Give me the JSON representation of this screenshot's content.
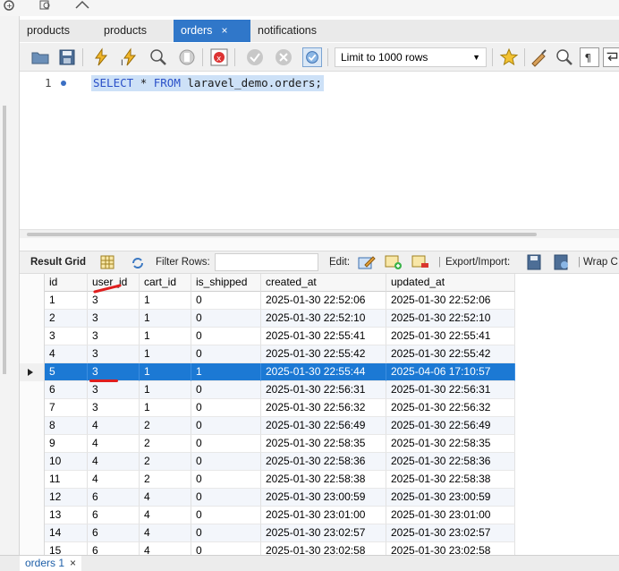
{
  "tabs": [
    {
      "label": "products",
      "active": false
    },
    {
      "label": "products",
      "active": false
    },
    {
      "label": "orders",
      "active": true,
      "close": "×"
    },
    {
      "label": "notifications",
      "active": false
    }
  ],
  "toolbar": {
    "limit_label": "Limit to 1000 rows",
    "icons": [
      "open-folder-icon",
      "save-icon",
      "execute-icon",
      "execute-current-icon",
      "explain-icon",
      "stop-icon",
      "toggle-error-icon",
      "commit-icon",
      "rollback-icon",
      "autocommit-icon",
      "bookmark-icon",
      "beautify-icon",
      "find-icon",
      "invisible-chars-icon",
      "wrap-icon"
    ]
  },
  "editor": {
    "line_number": "1",
    "sql": {
      "kw1": "SELECT",
      "star": "*",
      "kw2": "FROM",
      "table": "laravel_demo.orders;"
    }
  },
  "result_toolbar": {
    "result_grid": "Result Grid",
    "filter_rows": "Filter Rows:",
    "edit": "Edit:",
    "export_import": "Export/Import:",
    "wrap": "Wrap C"
  },
  "grid": {
    "columns": [
      "id",
      "user_id",
      "cart_id",
      "is_shipped",
      "created_at",
      "updated_at"
    ],
    "rows": [
      [
        "1",
        "3",
        "1",
        "0",
        "2025-01-30 22:52:06",
        "2025-01-30 22:52:06"
      ],
      [
        "2",
        "3",
        "1",
        "0",
        "2025-01-30 22:52:10",
        "2025-01-30 22:52:10"
      ],
      [
        "3",
        "3",
        "1",
        "0",
        "2025-01-30 22:55:41",
        "2025-01-30 22:55:41"
      ],
      [
        "4",
        "3",
        "1",
        "0",
        "2025-01-30 22:55:42",
        "2025-01-30 22:55:42"
      ],
      [
        "5",
        "3",
        "1",
        "1",
        "2025-01-30 22:55:44",
        "2025-04-06 17:10:57"
      ],
      [
        "6",
        "3",
        "1",
        "0",
        "2025-01-30 22:56:31",
        "2025-01-30 22:56:31"
      ],
      [
        "7",
        "3",
        "1",
        "0",
        "2025-01-30 22:56:32",
        "2025-01-30 22:56:32"
      ],
      [
        "8",
        "4",
        "2",
        "0",
        "2025-01-30 22:56:49",
        "2025-01-30 22:56:49"
      ],
      [
        "9",
        "4",
        "2",
        "0",
        "2025-01-30 22:58:35",
        "2025-01-30 22:58:35"
      ],
      [
        "10",
        "4",
        "2",
        "0",
        "2025-01-30 22:58:36",
        "2025-01-30 22:58:36"
      ],
      [
        "11",
        "4",
        "2",
        "0",
        "2025-01-30 22:58:38",
        "2025-01-30 22:58:38"
      ],
      [
        "12",
        "6",
        "4",
        "0",
        "2025-01-30 23:00:59",
        "2025-01-30 23:00:59"
      ],
      [
        "13",
        "6",
        "4",
        "0",
        "2025-01-30 23:01:00",
        "2025-01-30 23:01:00"
      ],
      [
        "14",
        "6",
        "4",
        "0",
        "2025-01-30 23:02:57",
        "2025-01-30 23:02:57"
      ],
      [
        "15",
        "6",
        "4",
        "0",
        "2025-01-30 23:02:58",
        "2025-01-30 23:02:58"
      ]
    ],
    "selected_row": 4
  },
  "bottom_tab": {
    "label": "orders 1",
    "close": "×"
  },
  "colors": {
    "accent": "#3077c9",
    "selection": "#1c79d4",
    "annotation": "#e01e1e"
  }
}
